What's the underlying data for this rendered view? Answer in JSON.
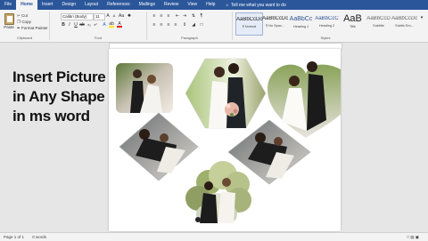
{
  "tabs": [
    "File",
    "Home",
    "Insert",
    "Design",
    "Layout",
    "References",
    "Mailings",
    "Review",
    "View",
    "Help"
  ],
  "tell_me": "Tell me what you want to do",
  "clipboard": {
    "paste": "Paste",
    "cut": "Cut",
    "copy": "Copy",
    "format_painter": "Format Painter",
    "label": "Clipboard"
  },
  "font": {
    "name": "Calibri (Body)",
    "size": "11",
    "label": "Font"
  },
  "paragraph": {
    "label": "Paragraph"
  },
  "styles": {
    "label": "Styles",
    "items": [
      {
        "preview": "AaBbCcDc",
        "name": "¶ Normal"
      },
      {
        "preview": "AaBbCcDc",
        "name": "¶ No Spac..."
      },
      {
        "preview": "AaBbCc",
        "name": "Heading 1"
      },
      {
        "preview": "AaBbCcC",
        "name": "Heading 2"
      },
      {
        "preview": "AaB",
        "name": "Title"
      },
      {
        "preview": "AaBbCcD",
        "name": "Subtitle"
      },
      {
        "preview": "AaBbCcDc",
        "name": "Subtle Em..."
      }
    ]
  },
  "overlay_title": [
    "Insert Picture",
    "in Any Shape",
    "in ms word"
  ],
  "status": {
    "page": "Page 1 of 1",
    "words": "0 words"
  }
}
